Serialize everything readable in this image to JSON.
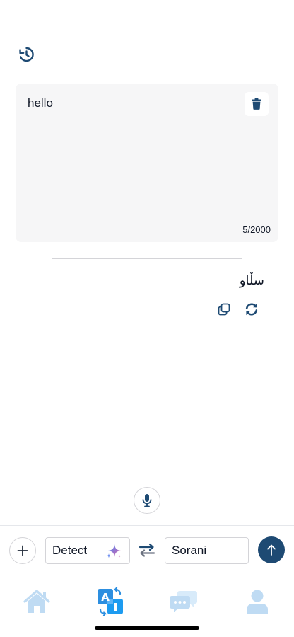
{
  "history": {
    "icon": "history-icon"
  },
  "input": {
    "text": "hello",
    "char_count": "5/2000",
    "clear_icon": "trash-icon"
  },
  "output": {
    "text": "سڵاو",
    "copy_icon": "copy-icon",
    "refresh_icon": "refresh-icon"
  },
  "mic": {
    "icon": "microphone-icon"
  },
  "toolbar": {
    "add_icon": "plus-icon",
    "source_language": "Detect",
    "sparkle_icon": "sparkle-icon",
    "swap_icon": "swap-icon",
    "target_language": "Sorani",
    "send_icon": "arrow-up-icon"
  },
  "nav": {
    "items": [
      {
        "name": "home",
        "icon": "home-icon",
        "active": false
      },
      {
        "name": "translate",
        "icon": "translate-ai-icon",
        "active": true
      },
      {
        "name": "chat",
        "icon": "chat-icon",
        "active": false
      },
      {
        "name": "profile",
        "icon": "user-icon",
        "active": false
      }
    ]
  },
  "colors": {
    "primary": "#1e4a73",
    "nav_inactive": "#bfdbf3",
    "nav_active": "#1d9bf0",
    "card_bg": "#f6f6f7"
  }
}
